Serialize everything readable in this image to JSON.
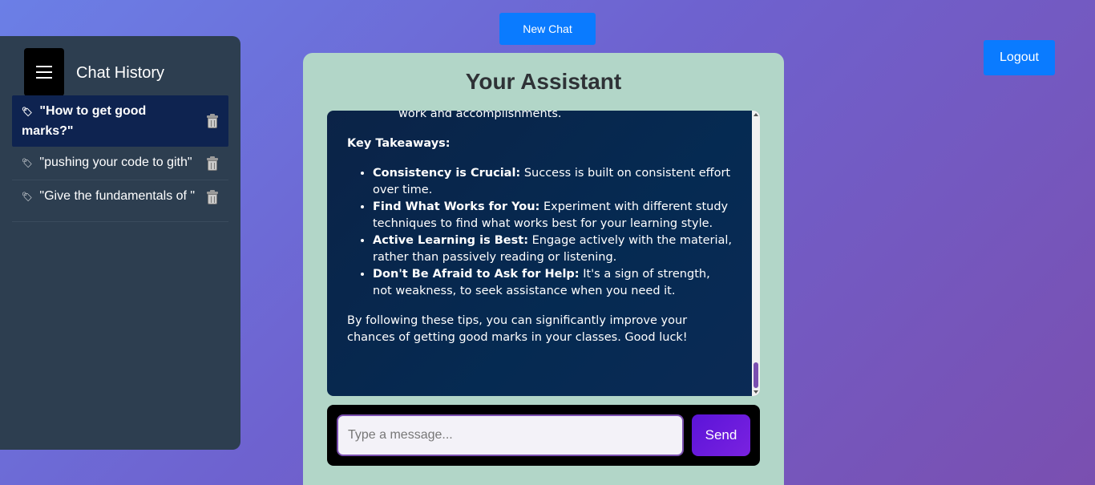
{
  "header": {
    "new_chat_label": "New Chat",
    "logout_label": "Logout"
  },
  "sidebar": {
    "title": "Chat History",
    "items": [
      {
        "icon": "🏷",
        "label": "\"How to get good marks?\"",
        "active": true
      },
      {
        "icon": "🏷",
        "label": "\"pushing your code to gith\"",
        "active": false
      },
      {
        "icon": "🏷",
        "label": "\"Give the fundamentals of \"",
        "active": false
      }
    ]
  },
  "main": {
    "title": "Your Assistant",
    "chat": {
      "prev_text": "work and accomplishments.",
      "heading": "Key Takeaways:",
      "bullets": [
        {
          "bold": "Consistency is Crucial:",
          "text": " Success is built on consistent effort over time."
        },
        {
          "bold": "Find What Works for You:",
          "text": " Experiment with different study techniques to find what works best for your learning style."
        },
        {
          "bold": "Active Learning is Best:",
          "text": " Engage actively with the material, rather than passively reading or listening."
        },
        {
          "bold": "Don't Be Afraid to Ask for Help:",
          "text": " It's a sign of strength, not weakness, to seek assistance when you need it."
        }
      ],
      "closing": "By following these tips, you can significantly improve your chances of getting good marks in your classes. Good luck!"
    },
    "input": {
      "value": "",
      "placeholder": "Type a message..."
    },
    "send_label": "Send"
  },
  "colors": {
    "accent": "#0a7bff",
    "send": "#6a1bdc",
    "sidebar": "#2d3e50",
    "card": "#b2d6c8"
  }
}
